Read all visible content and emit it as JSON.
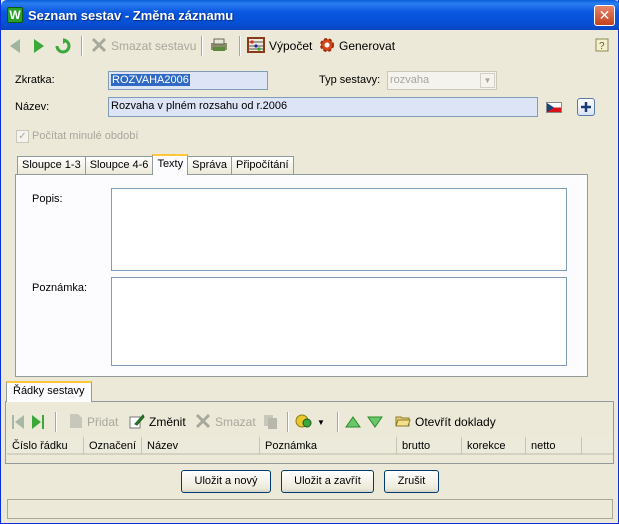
{
  "window": {
    "title": "Seznam sestav - Změna záznamu",
    "app_icon_letter": "W"
  },
  "toolbar": {
    "delete_label": "Smazat sestavu",
    "calc_label": "Výpočet",
    "generate_label": "Generovat"
  },
  "form": {
    "zkratka_label": "Zkratka:",
    "zkratka_value": "ROZVAHA2006",
    "typ_label": "Typ sestavy:",
    "typ_value": "rozvaha",
    "nazev_label": "Název:",
    "nazev_value": "Rozvaha v plném rozsahu od r.2006",
    "checkbox_label": "Počítat minulé období",
    "checkbox_checked": true
  },
  "tabs": [
    {
      "label": "Sloupce 1-3",
      "active": false
    },
    {
      "label": "Sloupce 4-6",
      "active": false
    },
    {
      "label": "Texty",
      "active": true
    },
    {
      "label": "Správa",
      "active": false
    },
    {
      "label": "Připočítání",
      "active": false
    }
  ],
  "texty": {
    "popis_label": "Popis:",
    "poznamka_label": "Poznámka:"
  },
  "rows_section": {
    "tab_label": "Řádky sestavy",
    "add_label": "Přidat",
    "edit_label": "Změnit",
    "delete_label": "Smazat",
    "open_label": "Otevřít doklady",
    "columns": [
      "Číslo řádku",
      "Označení",
      "Název",
      "Poznámka",
      "brutto",
      "korekce",
      "netto"
    ]
  },
  "buttons": {
    "save_new": "Uložit a nový",
    "save_close": "Uložit a zavřít",
    "cancel": "Zrušit"
  },
  "colors": {
    "title_blue": "#0a58e0",
    "field_highlight": "#dce4f5",
    "selection": "#316ac5",
    "tab_accent": "#ffc83c",
    "nav_green": "#3aa83a"
  }
}
